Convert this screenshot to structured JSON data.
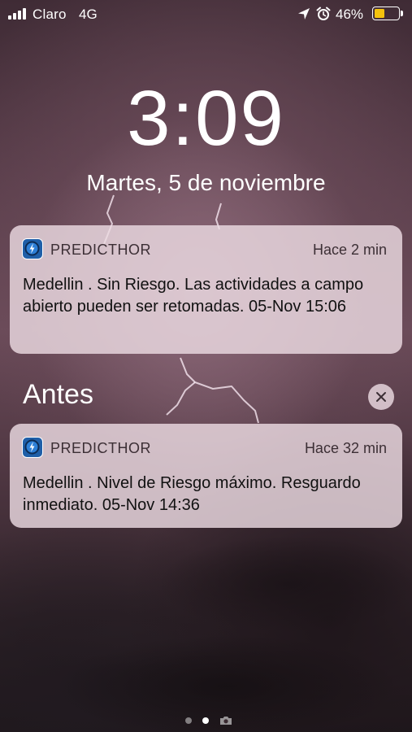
{
  "status_bar": {
    "carrier": "Claro",
    "network": "4G",
    "battery_percent": "46%",
    "battery_level": 0.46,
    "battery_color": "#f4c20d",
    "icons": [
      "signal-icon",
      "location-icon",
      "alarm-icon",
      "battery-icon"
    ]
  },
  "lock_screen": {
    "time": "3:09",
    "date": "Martes, 5 de noviembre"
  },
  "notifications": [
    {
      "app": "PREDICTHOR",
      "time": "Hace 2 min",
      "body": "Medellin . Sin Riesgo. Las actividades a campo abierto pueden ser retomadas. 05-Nov 15:06"
    },
    {
      "app": "PREDICTHOR",
      "time": "Hace 32 min",
      "body": "Medellin . Nivel de Riesgo máximo. Resguardo inmediato. 05-Nov 14:36"
    }
  ],
  "earlier_section": {
    "title": "Antes"
  },
  "page_indicator": {
    "pages": 2,
    "current": 2,
    "camera_icon": "camera-icon"
  }
}
